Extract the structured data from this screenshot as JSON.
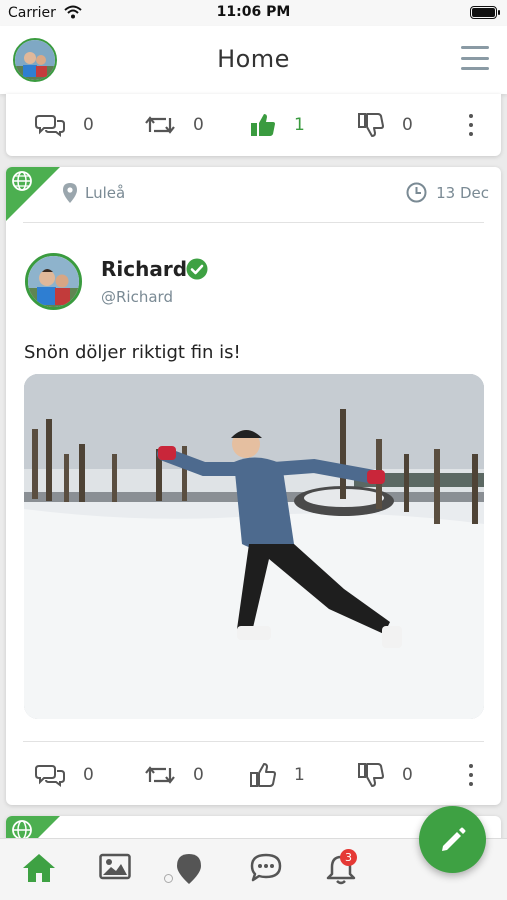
{
  "status_bar": {
    "carrier": "Carrier",
    "time": "11:06 PM"
  },
  "nav": {
    "title": "Home",
    "avatar": "user-avatar",
    "menu_icon": "hamburger-icon"
  },
  "previous_post": {
    "actions": {
      "comments": "0",
      "reposts": "0",
      "likes": "1",
      "dislikes": "0",
      "liked": true
    }
  },
  "post": {
    "visibility_icon": "globe-icon",
    "location": "Luleå",
    "date": "13 Dec",
    "author": {
      "name": "Richard",
      "handle": "@Richard",
      "verified": true
    },
    "text": "Snön döljer riktigt fin is!",
    "photo": "ice-skating-photo",
    "actions": {
      "comments": "0",
      "reposts": "0",
      "likes": "1",
      "dislikes": "0",
      "liked": false
    }
  },
  "next_post": {
    "visibility_icon": "globe-icon"
  },
  "tab_bar": {
    "items": [
      "home-icon",
      "image-icon",
      "map-pin-icon",
      "chat-icon",
      "bell-icon"
    ],
    "active": "home-icon",
    "notification_count": "3"
  },
  "fab": {
    "icon": "pencil-icon"
  },
  "colors": {
    "accent": "#3ea143",
    "muted": "#7a8a94",
    "badge": "#e53935"
  }
}
